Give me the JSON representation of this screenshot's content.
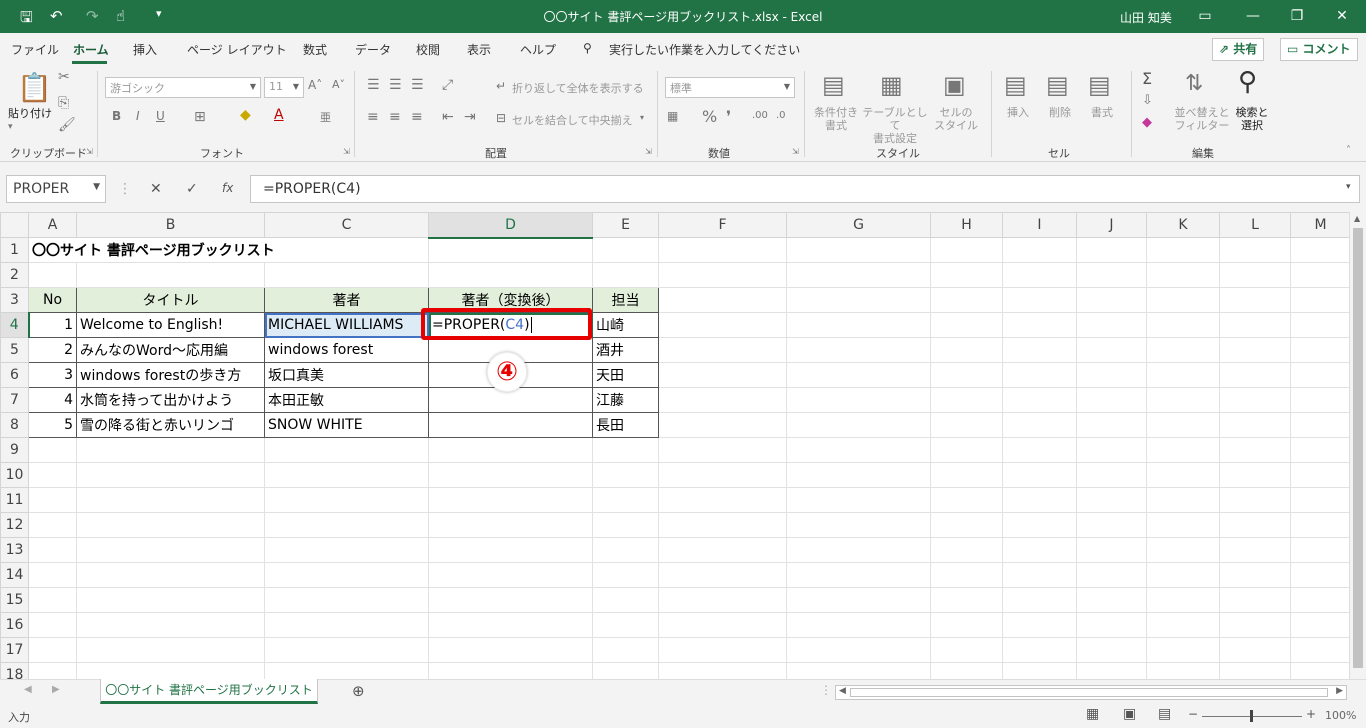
{
  "app": {
    "title": "〇〇サイト 書評ページ用ブックリスト.xlsx  -  Excel",
    "user": "山田 知美"
  },
  "ribbon_tabs": [
    "ファイル",
    "ホーム",
    "挿入",
    "ページ レイアウト",
    "数式",
    "データ",
    "校閲",
    "表示",
    "ヘルプ"
  ],
  "tell_me": "実行したい作業を入力してください",
  "share_label": "共有",
  "comment_label": "コメント",
  "ribbon": {
    "paste_label": "貼り付け",
    "font_name": "游ゴシック",
    "font_size": "11",
    "wrap_text": "折り返して全体を表示する",
    "merge_center": "セルを結合して中央揃え",
    "number_format": "標準",
    "cond_format": "条件付き\n書式",
    "table_format": "テーブルとして\n書式設定",
    "cell_style": "セルの\nスタイル",
    "insert": "挿入",
    "delete": "削除",
    "format": "書式",
    "sort_filter": "並べ替えと\nフィルター",
    "find_select": "検索と\n選択",
    "groups": {
      "clipboard": "クリップボード",
      "font": "フォント",
      "alignment": "配置",
      "number": "数値",
      "styles": "スタイル",
      "cells": "セル",
      "editing": "編集"
    }
  },
  "formula_bar": {
    "name_box": "PROPER",
    "formula": "=PROPER(C4)"
  },
  "columns": [
    "A",
    "B",
    "C",
    "D",
    "E",
    "F",
    "G",
    "H",
    "I",
    "J",
    "K",
    "L",
    "M"
  ],
  "rows": [
    "1",
    "2",
    "3",
    "4",
    "5",
    "6",
    "7",
    "8",
    "9",
    "10",
    "11",
    "12",
    "13",
    "14",
    "15",
    "16",
    "17",
    "18"
  ],
  "sheet": {
    "title": "〇〇サイト 書評ページ用ブックリスト",
    "headers": [
      "No",
      "タイトル",
      "著者",
      "著者（変換後）",
      "担当"
    ],
    "records": [
      {
        "no": "1",
        "title": "Welcome to English!",
        "author": "MICHAEL WILLIAMS",
        "staff": "山崎"
      },
      {
        "no": "2",
        "title": "みんなのWord～応用編",
        "author": "windows forest",
        "staff": "酒井"
      },
      {
        "no": "3",
        "title": "windows forestの歩き方",
        "author": "坂口真美",
        "staff": "天田"
      },
      {
        "no": "4",
        "title": "水筒を持って出かけよう",
        "author": "本田正敏",
        "staff": "江藤"
      },
      {
        "no": "5",
        "title": "雪の降る街と赤いリンゴ",
        "author": "SNOW WHITE",
        "staff": "長田"
      }
    ],
    "edit_prefix": "=PROPER(",
    "edit_ref": "C4",
    "edit_suffix": ")"
  },
  "step_label": "④",
  "sheet_tab": "〇〇サイト 書評ページ用ブックリスト",
  "status": {
    "mode": "入力",
    "zoom": "100%"
  },
  "colors": {
    "excel_green": "#217346",
    "header_fill": "#e2efda",
    "annotation_red": "#e60000",
    "ref_blue": "#4472c4"
  }
}
